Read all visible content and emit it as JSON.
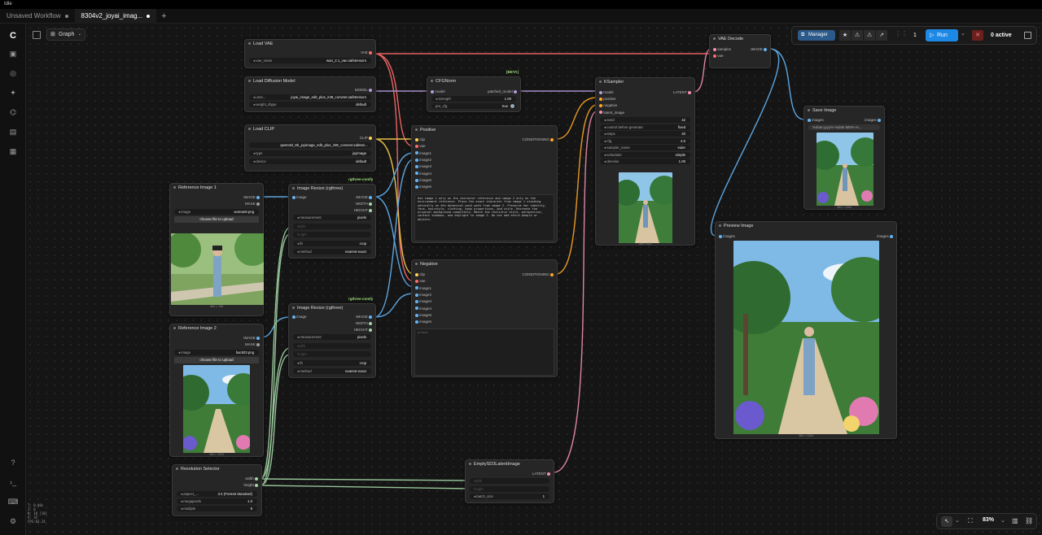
{
  "window": {
    "title": "Idle"
  },
  "tabs": [
    {
      "label": "Unsaved Workflow"
    },
    {
      "label": "8304v2_joyai_imag..."
    }
  ],
  "toolbar": {
    "graph_label": "Graph"
  },
  "topbar": {
    "manager": "Manager",
    "queue_count": "1",
    "run": "Run",
    "active": "0 active"
  },
  "zoom": "83%",
  "stats": [
    "T: 0.00s",
    "I: 0",
    "N: 18 [18]",
    "V: 35",
    "FPS:83.24"
  ],
  "nodes": {
    "load_vae": {
      "title": "Load VAE",
      "out": "VAE",
      "vae_name_label": "vae_name",
      "vae_name": "wan_2.1_vae.safetensors"
    },
    "load_diffusion": {
      "title": "Load Diffusion Model",
      "out": "MODEL",
      "unet_label": "unet...",
      "unet": "joyai_image_edit_plus_int8_convnet.safetensors",
      "dtype_label": "weight_dtype",
      "dtype": "default"
    },
    "load_clip": {
      "title": "Load CLIP",
      "out": "CLIP",
      "clip_name": "qwen3vl_8b_joyimage_edit_plus_int8_convnet.safeten...",
      "type_label": "type",
      "type": "joyimage",
      "device_label": "device",
      "device": "default"
    },
    "cfgnorm": {
      "title": "CFGNorm",
      "beta": "[BETA]",
      "in": "model",
      "out": "patched_model",
      "strength_label": "strength",
      "strength": "1.00",
      "pre_cfg_label": "pre_cfg",
      "pre_cfg": "true"
    },
    "ksampler": {
      "title": "KSampler",
      "inputs": [
        "model",
        "positive",
        "negative",
        "latent_image"
      ],
      "out": "LATENT",
      "widgets": [
        {
          "label": "seed",
          "value": "42"
        },
        {
          "label": "control before generate",
          "value": "fixed"
        },
        {
          "label": "steps",
          "value": "20"
        },
        {
          "label": "cfg",
          "value": "4.0"
        },
        {
          "label": "sampler_name",
          "value": "euler"
        },
        {
          "label": "scheduler",
          "value": "simple"
        },
        {
          "label": "denoise",
          "value": "1.00"
        }
      ],
      "caption": "384 × 512"
    },
    "vae_decode": {
      "title": "VAE Decode",
      "inputs": [
        "samples",
        "vae"
      ],
      "out": "IMAGE"
    },
    "save_image": {
      "title": "Save Image",
      "in": "images",
      "out": "images",
      "prefix": "%date:yyyy%-%date:MM%-%...",
      "caption": "384 × 1264"
    },
    "preview": {
      "title": "Preview Image",
      "in": "images",
      "out": "images",
      "caption": "384 × 1264"
    },
    "positive": {
      "title": "Positive",
      "inputs": [
        "clip",
        "vae",
        "image1",
        "image2",
        "image3",
        "image4",
        "image5",
        "image6"
      ],
      "out": "CONDITIONING",
      "text": "Use image 1 only as the character reference and image 2 only as the environment reference. Place the exact character from image 1 standing naturally on the botanical park path from image 2. Preserve her identity, face, hairstyle, clothing, body proportions, and style. Recreate the original background completely. Match the realistic style, perspective, contact shadows, and daylight to image 2. Do not add extra people or objects."
    },
    "negative": {
      "title": "Negative",
      "inputs": [
        "clip",
        "vae",
        "image1",
        "image2",
        "image3",
        "image4",
        "image5",
        "image6"
      ],
      "out": "CONDITIONING",
      "placeholder": "prompt"
    },
    "ref1": {
      "title": "Reference Image 1",
      "outs": [
        "IMAGE",
        "MASK"
      ],
      "image_label": "image",
      "image": "woman8.png",
      "upload": "choose file to upload",
      "caption": "683 × 768"
    },
    "ref2": {
      "title": "Reference Image 2",
      "outs": [
        "IMAGE",
        "MASK"
      ],
      "image_label": "image",
      "image": "back03.png",
      "upload": "choose file to upload",
      "caption": "384 × 1024"
    },
    "resize1": {
      "title": "Image Resize (rgthree)",
      "tag": "rgthree-comfy",
      "in": "image",
      "outs": [
        "IMAGE",
        "WIDTH",
        "HEIGHT"
      ],
      "widgets": [
        {
          "label": "measurement",
          "value": "pixels"
        },
        {
          "label": "width",
          "value": ""
        },
        {
          "label": "height",
          "value": ""
        },
        {
          "label": "fit",
          "value": "crop"
        },
        {
          "label": "method",
          "value": "nearest-exact"
        }
      ]
    },
    "resize2": {
      "title": "Image Resize (rgthree)",
      "tag": "rgthree-comfy",
      "in": "image",
      "outs": [
        "IMAGE",
        "WIDTH",
        "HEIGHT"
      ],
      "widgets": [
        {
          "label": "measurement",
          "value": "pixels"
        },
        {
          "label": "width",
          "value": ""
        },
        {
          "label": "height",
          "value": ""
        },
        {
          "label": "fit",
          "value": "crop"
        },
        {
          "label": "method",
          "value": "nearest-exact"
        }
      ]
    },
    "resolution": {
      "title": "Resolution Selector",
      "outs": [
        "width",
        "height"
      ],
      "widgets": [
        {
          "label": "aspect_...",
          "value": "3:4 (Portrait Standard)"
        },
        {
          "label": "megapixels",
          "value": "1.0"
        },
        {
          "label": "multiple",
          "value": "8"
        }
      ]
    },
    "empty_latent": {
      "title": "EmptySD3LatentImage",
      "out": "LATENT",
      "widgets": [
        {
          "label": "width",
          "value": ""
        },
        {
          "label": "height",
          "value": ""
        },
        {
          "label": "batch_size",
          "value": "1"
        }
      ]
    }
  },
  "colors": {
    "vae": "#ff6b6b",
    "model": "#b39ddb",
    "clip": "#ffd54f",
    "image": "#64b5f6",
    "cond": "#ffa726",
    "latent": "#f48fb1",
    "int": "#a5d6a7"
  }
}
